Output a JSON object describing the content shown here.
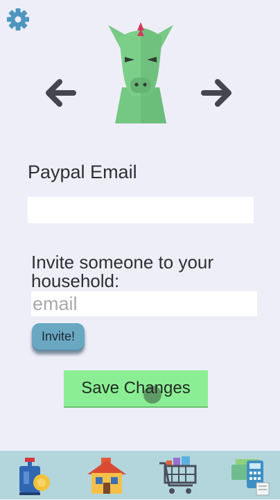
{
  "header": {
    "settings_icon": "gear-icon",
    "prev_icon": "arrow-left-icon",
    "next_icon": "arrow-right-icon",
    "avatar_icon": "dragon-avatar-icon"
  },
  "form": {
    "paypal_label": "Paypal Email",
    "paypal_value": "",
    "invite_label": "Invite someone to your household:",
    "email_placeholder": "email",
    "invite_button": "Invite!",
    "save_button": "Save Changes"
  },
  "nav": {
    "items": [
      {
        "icon": "chores-cleaning-icon"
      },
      {
        "icon": "house-icon"
      },
      {
        "icon": "shopping-cart-icon"
      },
      {
        "icon": "bills-calculator-icon"
      }
    ]
  },
  "colors": {
    "background": "#eeeef8",
    "nav_bar": "#b3d6dd",
    "save_button": "#8cee94",
    "invite_button": "#6aa8c2",
    "settings_icon": "#4f96bf",
    "arrow": "#45454f",
    "avatar": "#7ccf88"
  }
}
